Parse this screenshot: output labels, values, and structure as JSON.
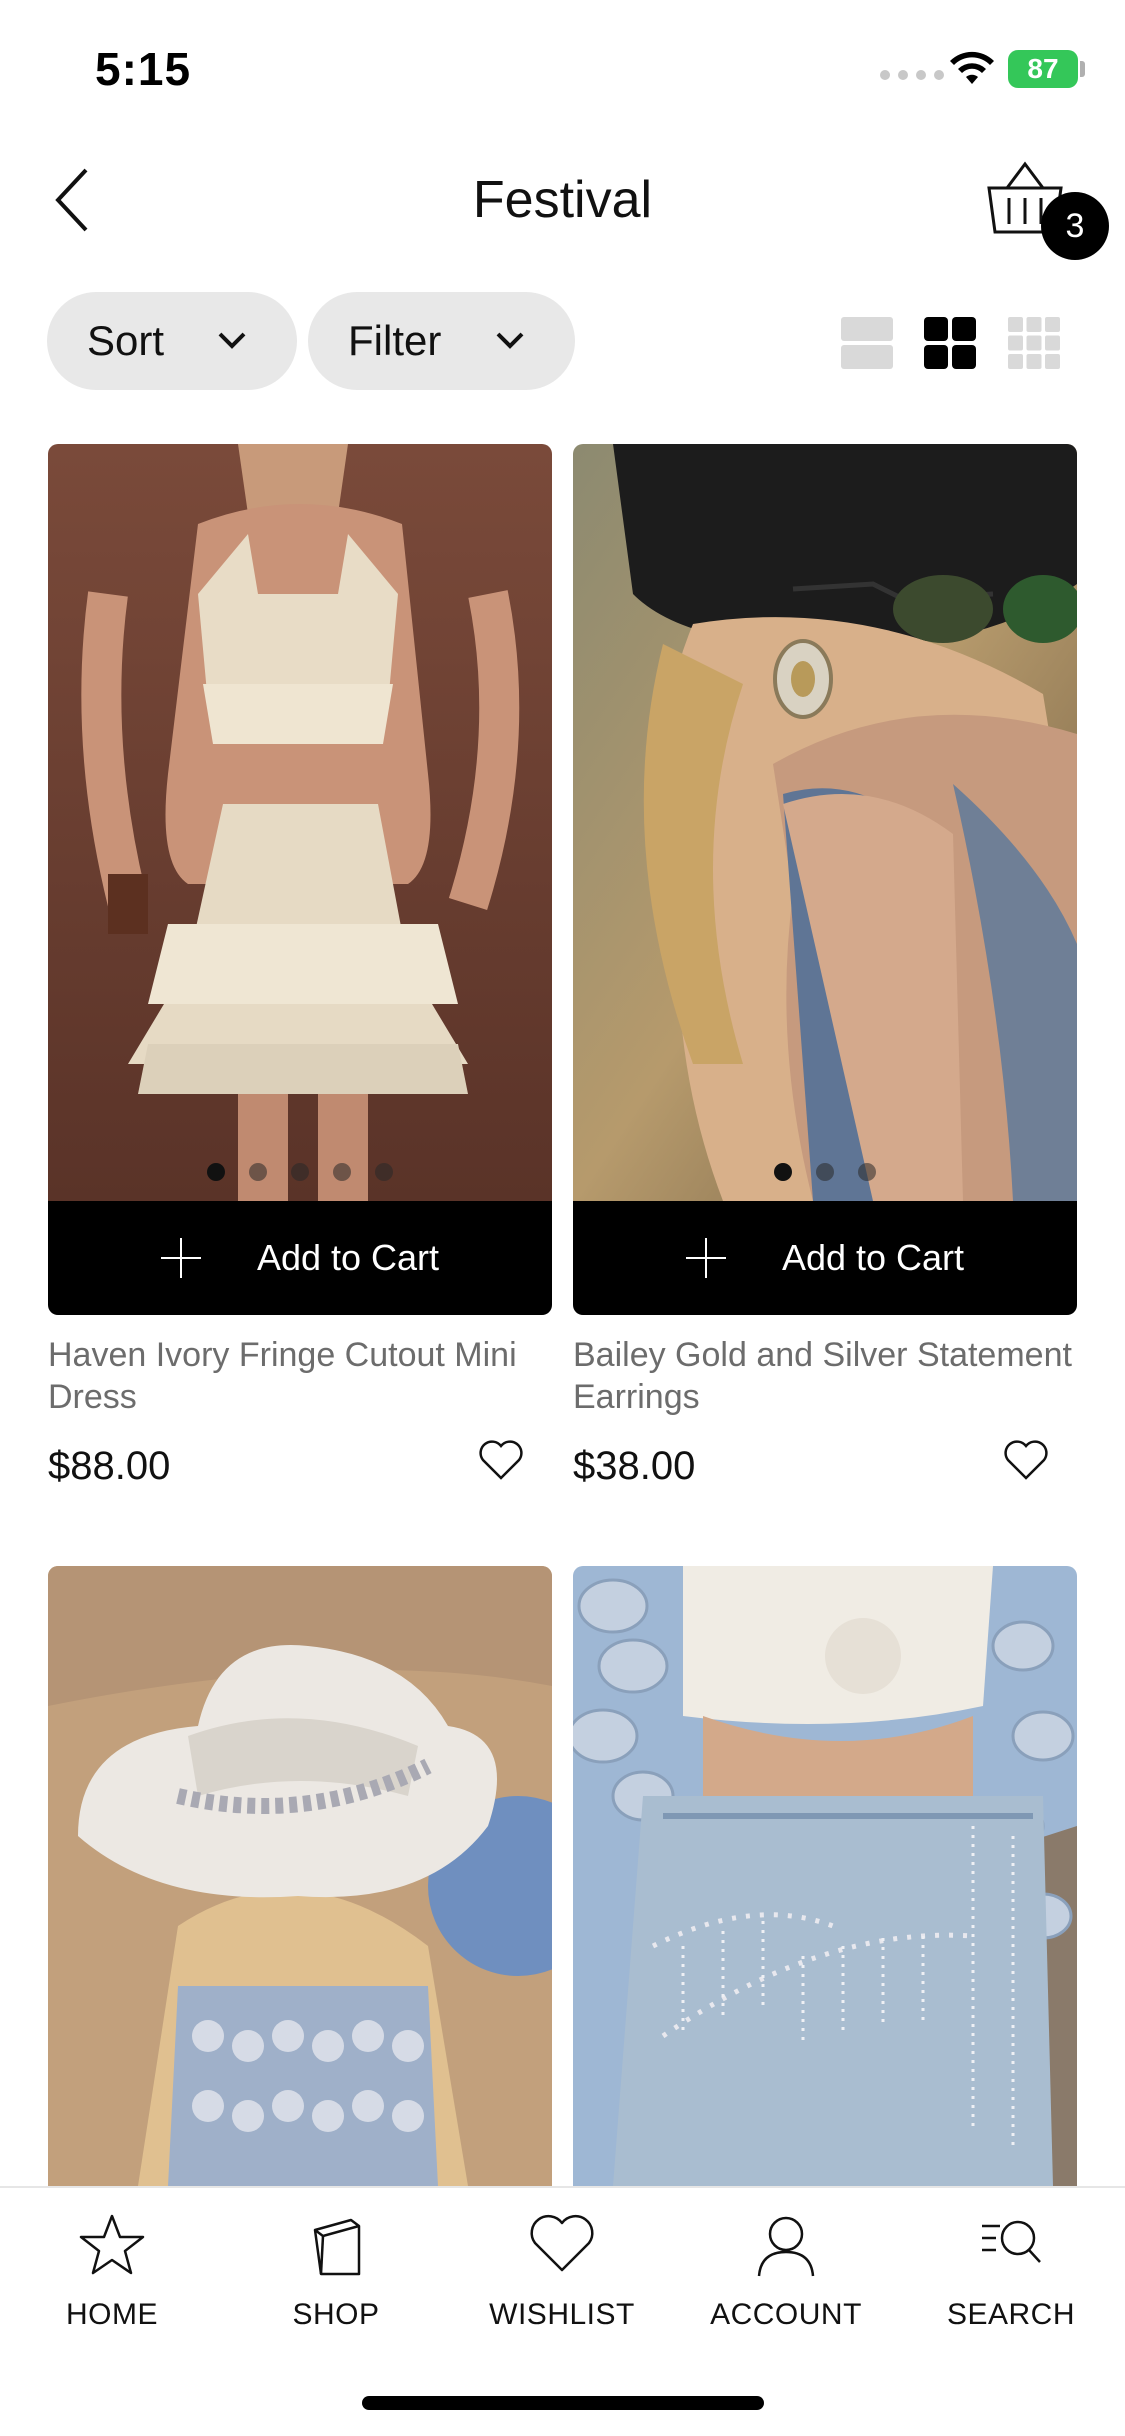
{
  "status_bar": {
    "time": "5:15",
    "battery": "87"
  },
  "header": {
    "title": "Festival",
    "cart_count": "3"
  },
  "controls": {
    "sort_label": "Sort",
    "filter_label": "Filter"
  },
  "products": [
    {
      "name": "Haven Ivory Fringe Cutout Mini Dress",
      "price": "$88.00",
      "add_label": "Add to Cart",
      "image_count": 5
    },
    {
      "name": "Bailey Gold and Silver Statement Earrings",
      "price": "$38.00",
      "add_label": "Add to Cart",
      "image_count": 3
    },
    {
      "name": "",
      "price": ""
    },
    {
      "name": "",
      "price": ""
    }
  ],
  "tab_bar": {
    "home": "HOME",
    "shop": "SHOP",
    "wishlist": "WISHLIST",
    "account": "ACCOUNT",
    "search": "SEARCH"
  },
  "colors": {
    "accent": "#000000",
    "pill": "#e8e8e8",
    "battery": "#34c759"
  }
}
